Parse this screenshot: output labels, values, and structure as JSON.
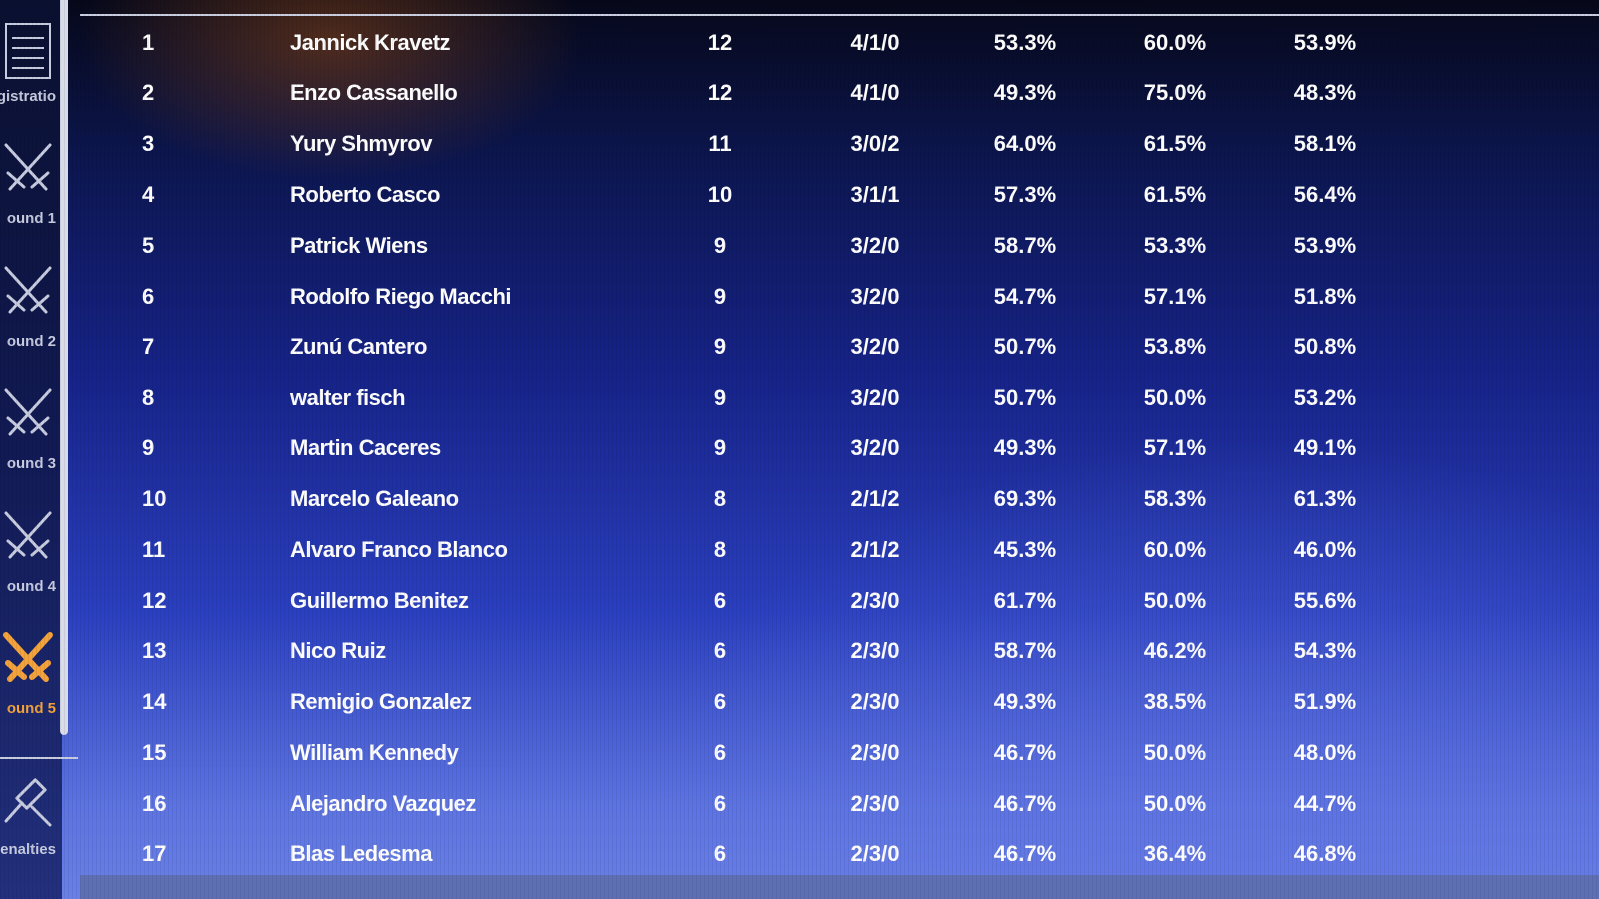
{
  "sidebar": {
    "items": [
      {
        "label": "gistratio",
        "icon": "registration-list-icon",
        "color": "#c7cbe0"
      },
      {
        "label": "ound 1",
        "icon": "crossed-swords-icon",
        "color": "#c7cbe0"
      },
      {
        "label": "ound 2",
        "icon": "crossed-swords-icon",
        "color": "#c7cbe0"
      },
      {
        "label": "ound 3",
        "icon": "crossed-swords-icon",
        "color": "#c7cbe0"
      },
      {
        "label": "ound 4",
        "icon": "crossed-swords-icon",
        "color": "#c7cbe0"
      },
      {
        "label": "ound 5",
        "icon": "crossed-swords-icon",
        "color": "#f4a23a",
        "active": true
      },
      {
        "label": "enalties",
        "icon": "gavel-icon",
        "color": "#c7cbe0"
      }
    ]
  },
  "standings": {
    "rows": [
      {
        "rank": "1",
        "name": "Jannick Kravetz",
        "points": "12",
        "record": "4/1/0",
        "p1": "53.3%",
        "p2": "60.0%",
        "p3": "53.9%"
      },
      {
        "rank": "2",
        "name": "Enzo Cassanello",
        "points": "12",
        "record": "4/1/0",
        "p1": "49.3%",
        "p2": "75.0%",
        "p3": "48.3%"
      },
      {
        "rank": "3",
        "name": "Yury Shmyrov",
        "points": "11",
        "record": "3/0/2",
        "p1": "64.0%",
        "p2": "61.5%",
        "p3": "58.1%"
      },
      {
        "rank": "4",
        "name": "Roberto Casco",
        "points": "10",
        "record": "3/1/1",
        "p1": "57.3%",
        "p2": "61.5%",
        "p3": "56.4%"
      },
      {
        "rank": "5",
        "name": "Patrick Wiens",
        "points": "9",
        "record": "3/2/0",
        "p1": "58.7%",
        "p2": "53.3%",
        "p3": "53.9%"
      },
      {
        "rank": "6",
        "name": "Rodolfo Riego Macchi",
        "points": "9",
        "record": "3/2/0",
        "p1": "54.7%",
        "p2": "57.1%",
        "p3": "51.8%"
      },
      {
        "rank": "7",
        "name": "Zunú Cantero",
        "points": "9",
        "record": "3/2/0",
        "p1": "50.7%",
        "p2": "53.8%",
        "p3": "50.8%"
      },
      {
        "rank": "8",
        "name": "walter fisch",
        "points": "9",
        "record": "3/2/0",
        "p1": "50.7%",
        "p2": "50.0%",
        "p3": "53.2%"
      },
      {
        "rank": "9",
        "name": "Martin Caceres",
        "points": "9",
        "record": "3/2/0",
        "p1": "49.3%",
        "p2": "57.1%",
        "p3": "49.1%"
      },
      {
        "rank": "10",
        "name": "Marcelo Galeano",
        "points": "8",
        "record": "2/1/2",
        "p1": "69.3%",
        "p2": "58.3%",
        "p3": "61.3%"
      },
      {
        "rank": "11",
        "name": "Alvaro Franco Blanco",
        "points": "8",
        "record": "2/1/2",
        "p1": "45.3%",
        "p2": "60.0%",
        "p3": "46.0%"
      },
      {
        "rank": "12",
        "name": "Guillermo Benitez",
        "points": "6",
        "record": "2/3/0",
        "p1": "61.7%",
        "p2": "50.0%",
        "p3": "55.6%"
      },
      {
        "rank": "13",
        "name": "Nico Ruiz",
        "points": "6",
        "record": "2/3/0",
        "p1": "58.7%",
        "p2": "46.2%",
        "p3": "54.3%"
      },
      {
        "rank": "14",
        "name": "Remigio Gonzalez",
        "points": "6",
        "record": "2/3/0",
        "p1": "49.3%",
        "p2": "38.5%",
        "p3": "51.9%"
      },
      {
        "rank": "15",
        "name": "William Kennedy",
        "points": "6",
        "record": "2/3/0",
        "p1": "46.7%",
        "p2": "50.0%",
        "p3": "48.0%"
      },
      {
        "rank": "16",
        "name": "Alejandro Vazquez",
        "points": "6",
        "record": "2/3/0",
        "p1": "46.7%",
        "p2": "50.0%",
        "p3": "44.7%"
      },
      {
        "rank": "17",
        "name": "Blas Ledesma",
        "points": "6",
        "record": "2/3/0",
        "p1": "46.7%",
        "p2": "36.4%",
        "p3": "46.8%"
      }
    ]
  }
}
